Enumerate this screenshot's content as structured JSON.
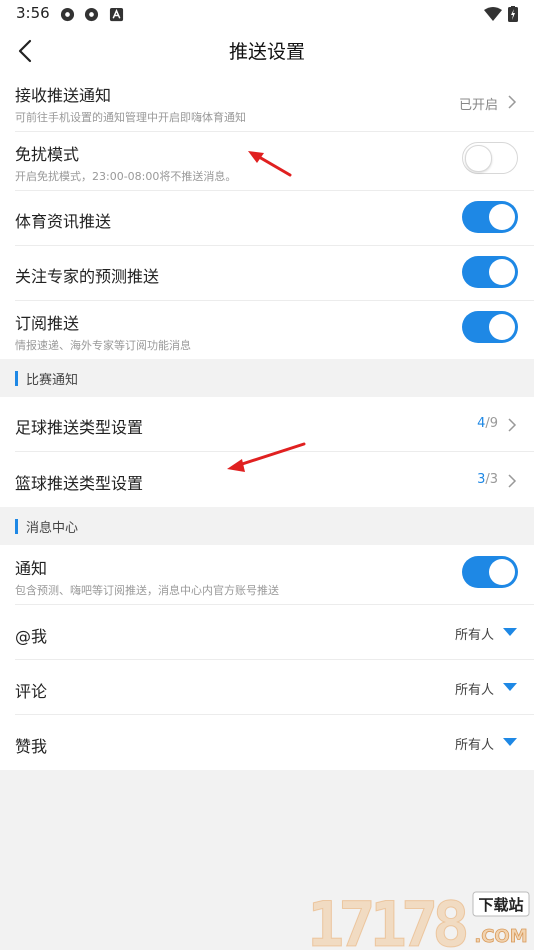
{
  "status_bar": {
    "time": "3:56"
  },
  "header": {
    "title": "推送设置"
  },
  "rows": {
    "receive": {
      "label": "接收推送通知",
      "sub": "可前往手机设置的通知管理中开启即嗨体育通知",
      "status": "已开启"
    },
    "dnd": {
      "label": "免扰模式",
      "sub": "开启免扰模式，23:00-08:00将不推送消息。",
      "toggle": "off"
    },
    "sports_news": {
      "label": "体育资讯推送",
      "toggle": "on"
    },
    "expert": {
      "label": "关注专家的预测推送",
      "toggle": "on"
    },
    "subscribe": {
      "label": "订阅推送",
      "sub": "情报速递、海外专家等订阅功能消息",
      "toggle": "on"
    }
  },
  "sections": {
    "match": "比赛通知",
    "message": "消息中心"
  },
  "match_rows": {
    "football": {
      "label": "足球推送类型设置",
      "selected": "4",
      "total": "/9"
    },
    "basketball": {
      "label": "篮球推送类型设置",
      "selected": "3",
      "total": "/3"
    }
  },
  "message_rows": {
    "notify": {
      "label": "通知",
      "sub": "包含预测、嗨吧等订阅推送，消息中心内官方账号推送",
      "toggle": "on"
    },
    "at_me": {
      "label": "@我",
      "value": "所有人"
    },
    "comment": {
      "label": "评论",
      "value": "所有人"
    },
    "like": {
      "label": "赞我",
      "value": "所有人"
    }
  },
  "watermark": {
    "number": "17178",
    "badge": "下载站",
    "domain": ".COM"
  },
  "colors": {
    "accent": "#1e88e5",
    "annotation_arrow": "#e02020"
  }
}
